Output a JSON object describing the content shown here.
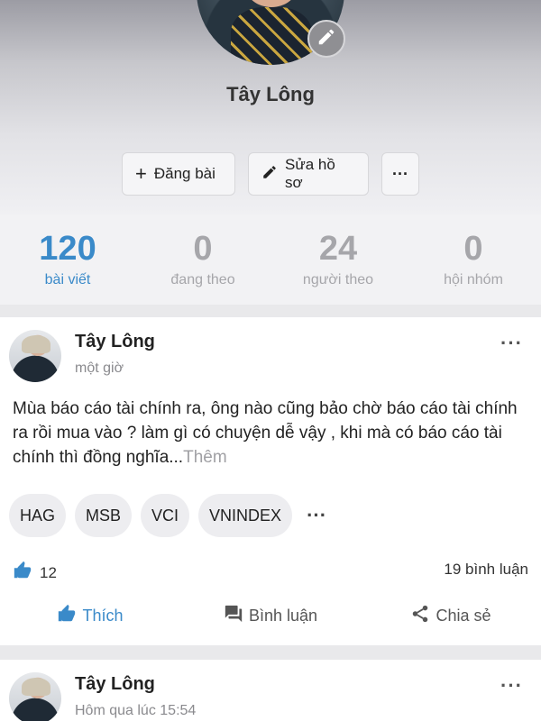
{
  "profile": {
    "name": "Tây Lông",
    "actions": {
      "post_label": "Đăng bài",
      "edit_label": "Sửa hồ sơ",
      "more_label": "···"
    }
  },
  "stats": [
    {
      "num": "120",
      "label": "bài viết"
    },
    {
      "num": "0",
      "label": "đang theo"
    },
    {
      "num": "24",
      "label": "người theo"
    },
    {
      "num": "0",
      "label": "hội nhóm"
    }
  ],
  "posts": [
    {
      "author": "Tây Lông",
      "time": "một giờ",
      "more": "···",
      "text": "Mùa báo cáo tài chính ra, ông nào cũng bảo chờ báo cáo tài chính ra rồi mua vào ? làm gì có chuyện dễ vậy , khi mà có báo cáo tài chính thì đồng nghĩa...",
      "more_link": "Thêm",
      "tags": [
        "HAG",
        "MSB",
        "VCI",
        "VNINDEX"
      ],
      "tags_more": "···",
      "likes": "12",
      "comments": "19 bình luận",
      "actions": {
        "like": "Thích",
        "comment": "Bình luận",
        "share": "Chia sẻ"
      }
    },
    {
      "author": "Tây Lông",
      "time": "Hôm qua lúc 15:54",
      "more": "···"
    }
  ],
  "colors": {
    "accent": "#3a8ac9",
    "muted": "#a6a6aa"
  }
}
